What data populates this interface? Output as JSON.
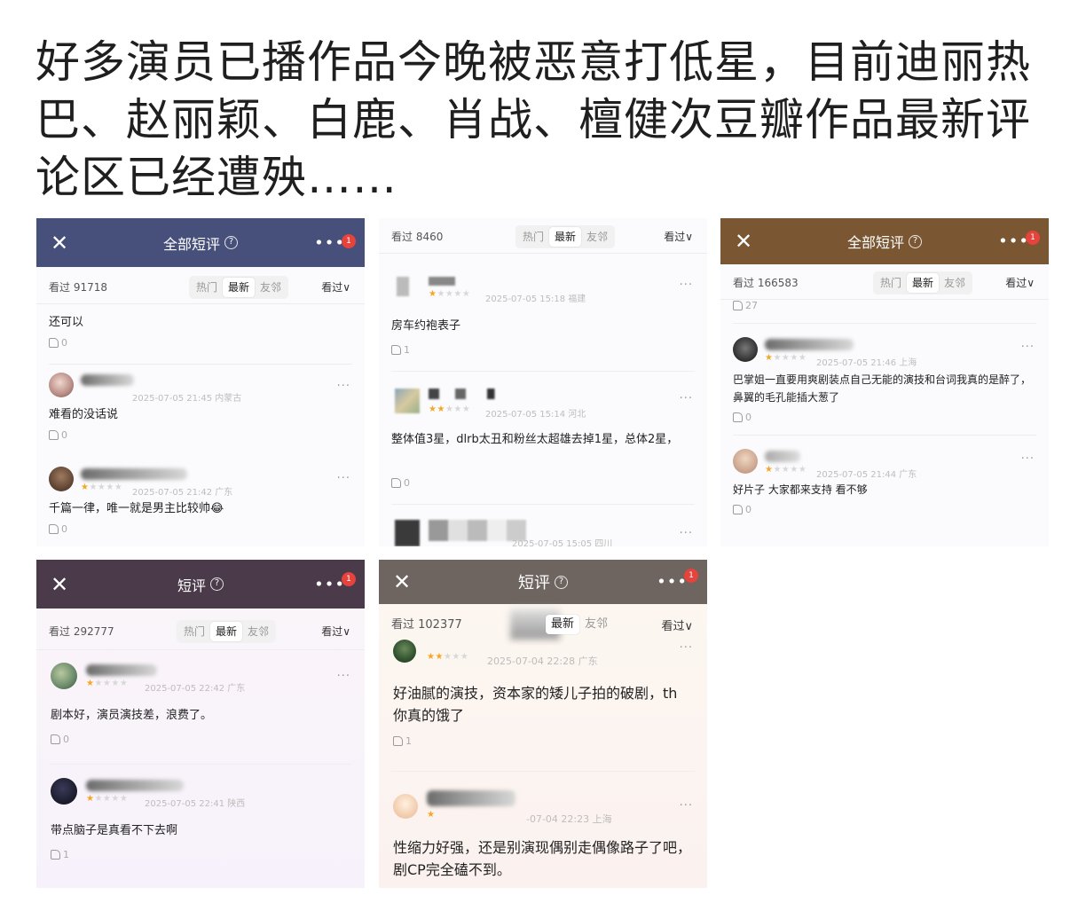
{
  "headline": "好多演员已播作品今晚被恶意打低星，目前迪丽热巴、赵丽颖、白鹿、肖战、檀健次豆瓣作品最新评论区已经遭殃……",
  "common": {
    "tab_hot": "热门",
    "tab_new": "最新",
    "tab_friends": "友邻",
    "sort": "看过∨",
    "close_icon": "✕",
    "more_icon": "•••",
    "help_icon": "?",
    "comment_more": "···",
    "thumb_icon": "thumbs-up-icon"
  },
  "colors": {
    "panel1_bar": "#47507a",
    "panel3_bar": "#7a5632",
    "panel4_bar": "#4a3a4a",
    "panel5_bar": "#6e6560",
    "star": "#f5a623"
  },
  "panels": [
    {
      "title": "全部短评",
      "badge": "1",
      "watched": "看过 91718",
      "comments": [
        {
          "text": "还可以",
          "likes": "0"
        },
        {
          "stars": 1,
          "meta": "2025-07-05 21:45 内蒙古",
          "text": "难看的没话说",
          "likes": "0"
        },
        {
          "stars": 1,
          "meta": "2025-07-05 21:42 广东",
          "text": "千篇一律，唯一就是男主比较帅😂",
          "likes": "0"
        }
      ]
    },
    {
      "watched": "看过 8460",
      "comments": [
        {
          "stars": 1,
          "meta": "2025-07-05 15:18 福建",
          "text": "房车约袍表子",
          "likes": "1"
        },
        {
          "stars": 2,
          "meta": "2025-07-05 15:14 河北",
          "text": "整体值3星，dlrb太丑和粉丝太超雄去掉1星，总体2星，",
          "likes": "0"
        },
        {
          "meta": "2025-07-05 15:05 四川"
        }
      ]
    },
    {
      "title": "全部短评",
      "badge": "1",
      "watched": "看过 166583",
      "top_likes": "27",
      "comments": [
        {
          "stars": 1,
          "meta": "2025-07-05 21:46 上海",
          "text": "巴掌姐一直要用爽剧装点自己无能的演技和台词我真的是醉了，鼻翼的毛孔能插大葱了",
          "likes": "0"
        },
        {
          "stars": 1,
          "meta": "2025-07-05 21:44 广东",
          "text": "好片子 大家都来支持 看不够",
          "likes": "0"
        }
      ]
    },
    {
      "title": "短评",
      "badge": "1",
      "watched": "看过 292777",
      "comments": [
        {
          "stars": 1,
          "meta": "2025-07-05 22:42 广东",
          "text": "剧本好，演员演技差，浪费了。",
          "likes": "0"
        },
        {
          "stars": 1,
          "meta": "2025-07-05 22:41 陕西",
          "text": "带点脑子是真看不下去啊",
          "likes": "1"
        }
      ]
    },
    {
      "title": "短评",
      "badge": "1",
      "watched": "看过 102377",
      "comments": [
        {
          "stars": 2,
          "meta": "2025-07-04 22:28 广东",
          "text": "好油腻的演技，资本家的矮儿子拍的破剧，th你真的饿了",
          "likes": "1"
        },
        {
          "stars": 1,
          "meta": "-07-04 22:23 上海",
          "text": "性缩力好强，还是别演现偶别走偶像路子了吧，剧CP完全磕不到。",
          "likes": ""
        }
      ]
    }
  ]
}
